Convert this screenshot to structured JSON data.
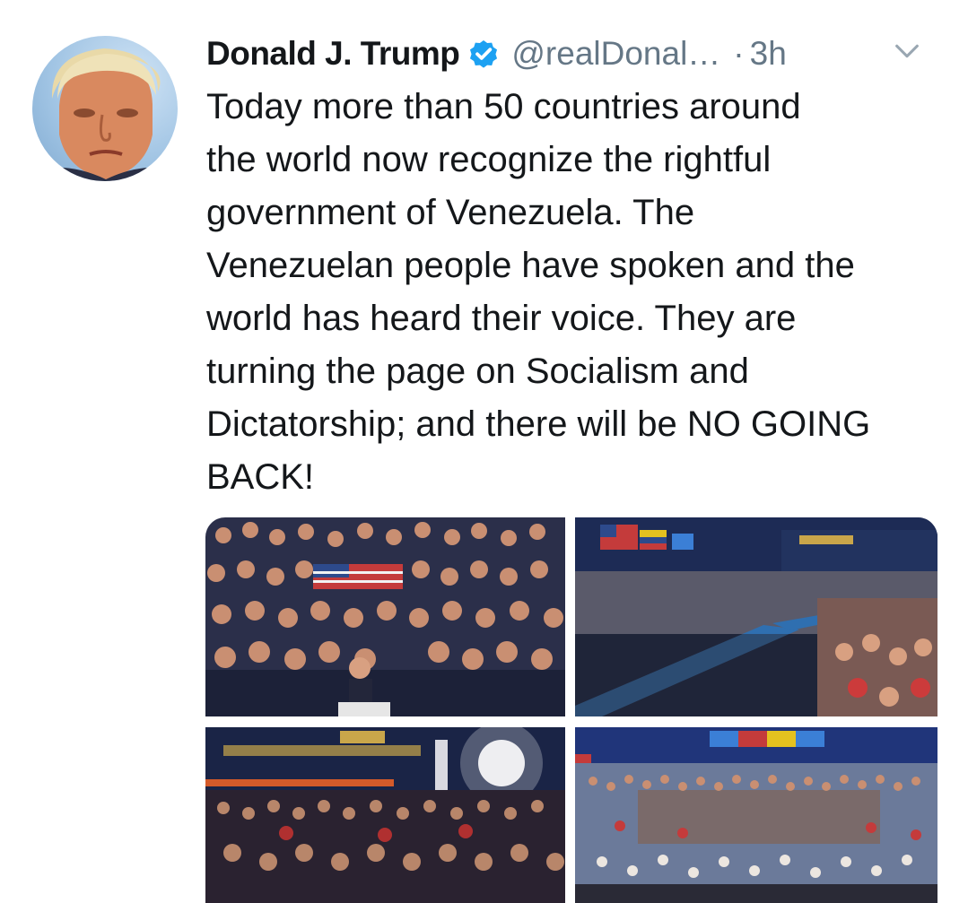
{
  "tweet": {
    "author_name": "Donald J. Trump",
    "handle": "@realDonal…",
    "separator": "·",
    "time": "3h",
    "verified": true,
    "text": "Today more than 50 countries around\nthe world now recognize the rightful\ngovernment of Venezuela. The\nVenezuelan people have spoken and the\nworld has heard their voice. They are\nturning the page on Socialism and\nDictatorship; and there will be NO GOING\nBACK!",
    "icons": {
      "verified": "verified-badge-icon",
      "menu": "chevron-down-icon"
    }
  },
  "colors": {
    "verified_blue": "#1da1f2",
    "muted_text": "#657786",
    "text": "#14171a"
  },
  "media": {
    "photo_count": 4
  }
}
